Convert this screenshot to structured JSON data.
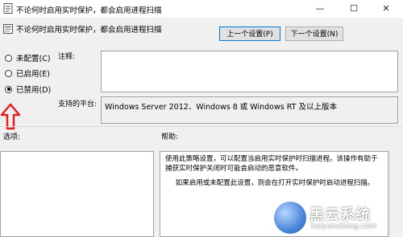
{
  "window": {
    "title": "不论何时启用实时保护，都会启用进程扫描",
    "minimize_glyph": "—",
    "maximize_glyph": "☐",
    "close_glyph": "✕"
  },
  "header": {
    "setting_name": "不论何时启用实时保护，都会启用进程扫描"
  },
  "nav": {
    "prev_label": "上一个设置(P)",
    "next_label": "下一个设置(N)"
  },
  "state": {
    "options": [
      {
        "label": "未配置(C)",
        "checked": false
      },
      {
        "label": "已启用(E)",
        "checked": false
      },
      {
        "label": "已禁用(D)",
        "checked": true
      }
    ]
  },
  "comment": {
    "label": "注释:",
    "value": ""
  },
  "platform": {
    "label": "支持的平台:",
    "value": "Windows Server 2012、Windows 8 或 Windows RT 及以上版本"
  },
  "options_section": {
    "label": "选项:"
  },
  "help_section": {
    "label": "帮助:",
    "paragraph1": "使用此策略设置，可以配置当启用实时保护时扫描进程。该操作有助于捕获实时保护关闭时可能会启动的恶意软件。",
    "paragraph2": "如果启用或未配置此设置，则会在打开实时保护时启动进程扫描。"
  },
  "annotation": {
    "color": "#e02020",
    "icon": "red-up-arrow-icon"
  },
  "watermark": {
    "title": "黑云系统",
    "url": "heiyunxitong.com"
  }
}
